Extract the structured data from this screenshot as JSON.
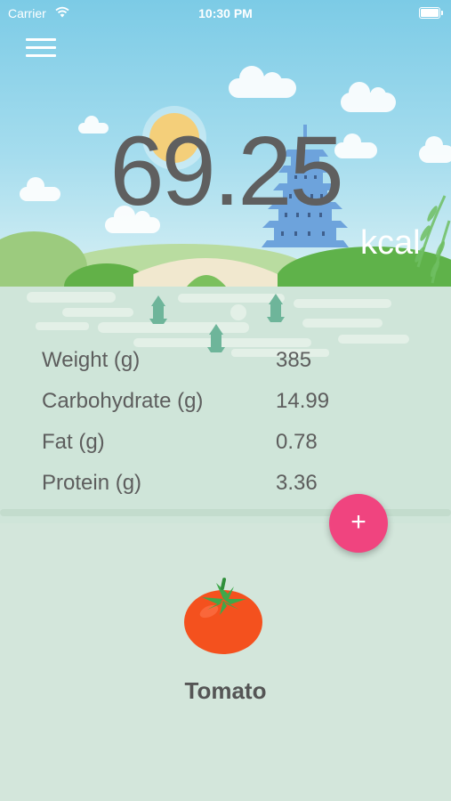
{
  "status_bar": {
    "carrier": "Carrier",
    "time": "10:30 PM"
  },
  "summary": {
    "kcal_value": "69.25",
    "kcal_unit": "kcal"
  },
  "nutrients": [
    {
      "label": "Weight (g)",
      "value": "385"
    },
    {
      "label": "Carbohydrate (g)",
      "value": "14.99"
    },
    {
      "label": "Fat (g)",
      "value": "0.78"
    },
    {
      "label": "Protein (g)",
      "value": "3.36"
    }
  ],
  "add_button": {
    "label": "+"
  },
  "food": {
    "name": "Tomato",
    "icon": "tomato-icon"
  },
  "colors": {
    "accent": "#f0447f",
    "sky": "#7ccbe6",
    "background": "#d3e6db",
    "text": "#5d5d5d"
  }
}
